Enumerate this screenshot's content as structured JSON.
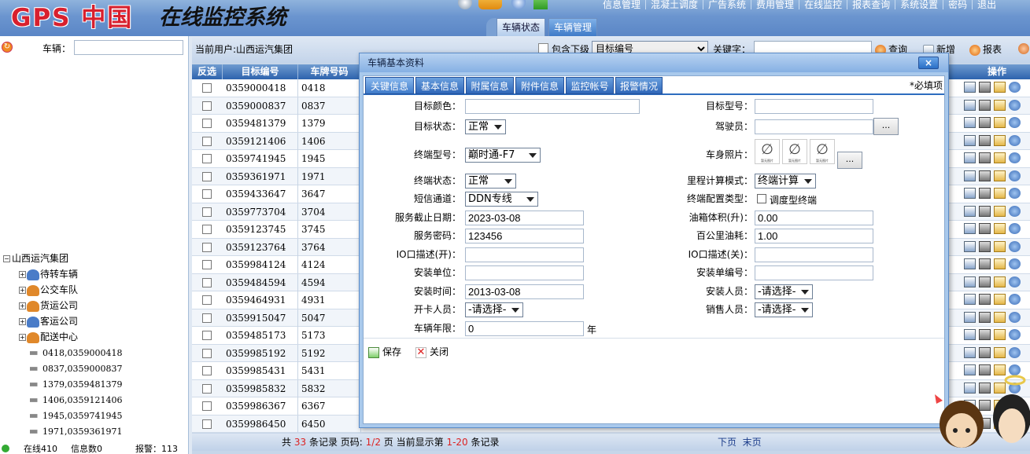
{
  "header": {
    "logo": "GPS 中国",
    "system_name": "在线监控系统",
    "nav": [
      "信息管理",
      "混凝土调度",
      "广告系统",
      "费用管理",
      "在线监控",
      "报表查询",
      "系统设置",
      "密码",
      "退出"
    ],
    "tabs": [
      {
        "label": "车辆状态",
        "active": false
      },
      {
        "label": "车辆管理",
        "active": true
      }
    ]
  },
  "left": {
    "vehicle_label": "车辆：",
    "vehicle_value": "",
    "tree": {
      "root": "山西运汽集团",
      "groups": [
        "待转车辆",
        "公交车队",
        "货运公司",
        "客运公司",
        "配送中心"
      ],
      "vehicles": [
        "0418,0359000418",
        "0837,0359000837",
        "1379,0359481379",
        "1406,0359121406",
        "1945,0359741945",
        "1971,0359361971"
      ]
    },
    "status": {
      "online": "在线410",
      "messages": "信息数0",
      "alarms": "报警：113"
    }
  },
  "main": {
    "current_user": "当前用户:山西运汽集团",
    "include_sub_label": "包含下级",
    "search_field": "目标编号",
    "keyword_label": "关键字：",
    "keyword_value": "",
    "query_label": "查询",
    "add_label": "新增",
    "report_label": "报表",
    "columns": {
      "select": "反选",
      "target_no": "目标编号",
      "plate": "车牌号码",
      "actions": "操作"
    },
    "rows": [
      [
        "0359000418",
        "0418"
      ],
      [
        "0359000837",
        "0837"
      ],
      [
        "0359481379",
        "1379"
      ],
      [
        "0359121406",
        "1406"
      ],
      [
        "0359741945",
        "1945"
      ],
      [
        "0359361971",
        "1971"
      ],
      [
        "0359433647",
        "3647"
      ],
      [
        "0359773704",
        "3704"
      ],
      [
        "0359123745",
        "3745"
      ],
      [
        "0359123764",
        "3764"
      ],
      [
        "0359984124",
        "4124"
      ],
      [
        "0359484594",
        "4594"
      ],
      [
        "0359464931",
        "4931"
      ],
      [
        "0359915047",
        "5047"
      ],
      [
        "0359485173",
        "5173"
      ],
      [
        "0359985192",
        "5192"
      ],
      [
        "0359985431",
        "5431"
      ],
      [
        "0359985832",
        "5832"
      ],
      [
        "0359986367",
        "6367"
      ],
      [
        "0359986450",
        "6450"
      ]
    ],
    "pager": {
      "p1": "共",
      "total": "33",
      "p2": "条记录 页码:",
      "page": "1/2",
      "p3": "页 当前显示第",
      "range": "1-20",
      "p4": "条记录",
      "next": "下页",
      "last": "末页"
    }
  },
  "dialog": {
    "title": "车辆基本资料",
    "close": "×",
    "required_note": "*必填项",
    "tabs": [
      "关键信息",
      "基本信息",
      "附属信息",
      "附件信息",
      "监控帐号",
      "报警情况"
    ],
    "active_tab": 0,
    "fields": {
      "target_color": {
        "label": "目标颜色：",
        "value": ""
      },
      "target_model": {
        "label": "目标型号：",
        "value": ""
      },
      "target_status": {
        "label": "目标状态：",
        "value": "正常"
      },
      "driver": {
        "label": "驾驶员：",
        "value": ""
      },
      "terminal_model": {
        "label": "终端型号：",
        "value": "巅时通-F7"
      },
      "body_photo": {
        "label": "车身照片：",
        "placeholder": "暂无图片"
      },
      "terminal_status": {
        "label": "终端状态：",
        "value": "正常"
      },
      "mileage_mode": {
        "label": "里程计算模式：",
        "value": "终端计算"
      },
      "sms_channel": {
        "label": "短信通道：",
        "value": "DDN专线"
      },
      "terminal_config": {
        "label": "终端配置类型：",
        "option": "调度型终端"
      },
      "service_end": {
        "label": "服务截止日期：",
        "value": "2023-03-08"
      },
      "tank_volume": {
        "label": "油箱体积(升)：",
        "value": "0.00"
      },
      "service_pwd": {
        "label": "服务密码：",
        "value": "123456"
      },
      "fuel_per_100": {
        "label": "百公里油耗：",
        "value": "1.00"
      },
      "io_open": {
        "label": "IO口描述(开)：",
        "value": ""
      },
      "io_close": {
        "label": "IO口描述(关)：",
        "value": ""
      },
      "install_unit": {
        "label": "安装单位：",
        "value": ""
      },
      "install_no": {
        "label": "安装单编号：",
        "value": ""
      },
      "install_time": {
        "label": "安装时间：",
        "value": "2013-03-08"
      },
      "installer": {
        "label": "安装人员：",
        "value": "-请选择-"
      },
      "card_opener": {
        "label": "开卡人员：",
        "value": "-请选择-"
      },
      "sales": {
        "label": "销售人员：",
        "value": "-请选择-"
      },
      "vehicle_years": {
        "label": "车辆年限：",
        "value": "0",
        "unit": "年"
      }
    },
    "browse_label": "...",
    "save_label": "保存",
    "close_label": "关闭"
  },
  "colors": {
    "header": "#6b95cf",
    "grid_header": "#2d63ad",
    "accent_red": "#d22222",
    "dialog_bg": "#a9c9ec"
  }
}
